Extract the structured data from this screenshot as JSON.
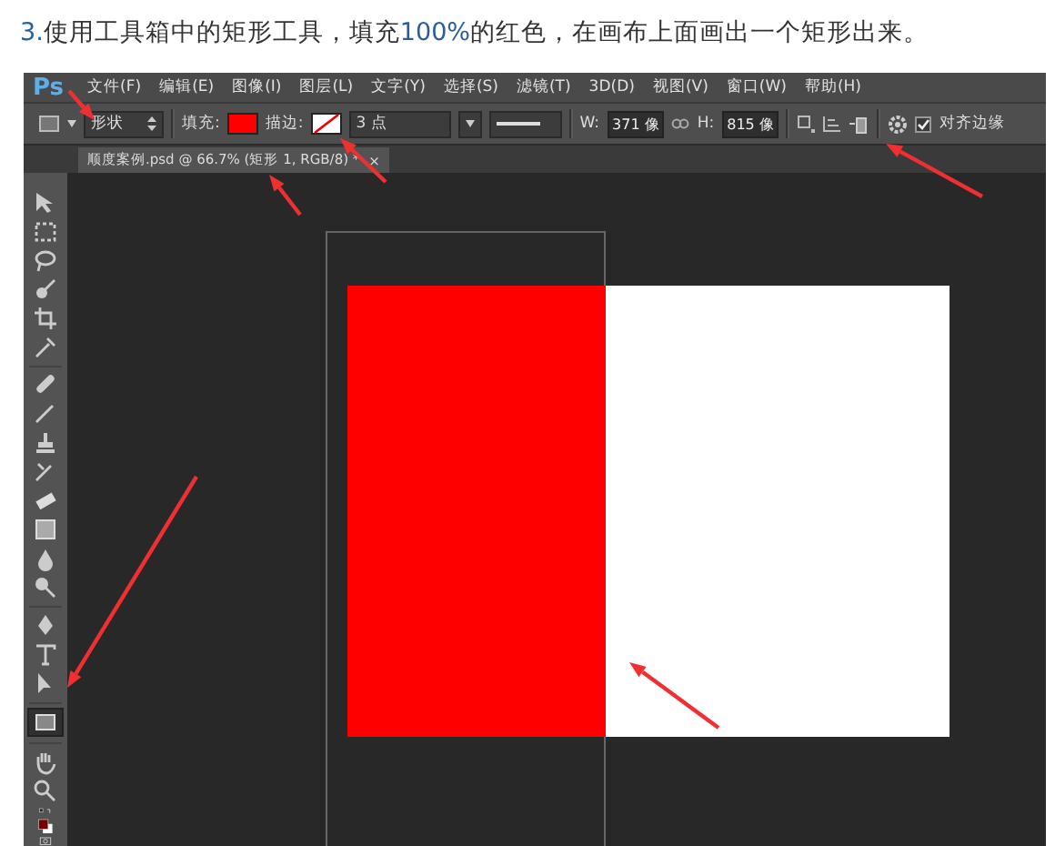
{
  "heading": [
    {
      "text": "3.",
      "kind": "number"
    },
    {
      "text": "使用工具箱中的矩形工具，填充",
      "kind": "plain"
    },
    {
      "text": "100%",
      "kind": "number"
    },
    {
      "text": "的红色，在画布上面画出一个矩形出来。",
      "kind": "plain"
    }
  ],
  "app": {
    "logo": "Ps",
    "menu": [
      "文件(F)",
      "编辑(E)",
      "图像(I)",
      "图层(L)",
      "文字(Y)",
      "选择(S)",
      "滤镜(T)",
      "3D(D)",
      "视图(V)",
      "窗口(W)",
      "帮助(H)"
    ],
    "options": {
      "mode": "形状",
      "fill_label": "填充:",
      "stroke_label": "描边:",
      "stroke_width": "3 点",
      "w_label": "W:",
      "w_value": "371 像",
      "h_label": "H:",
      "h_value": "815 像",
      "align_edges": {
        "label": "对齐边缘",
        "checked": true
      }
    },
    "tab": {
      "title": "顺度案例.psd @ 66.7% (矩形 1, RGB/8) *",
      "close": "×"
    },
    "tools": [
      {
        "selected": false
      },
      {
        "selected": false
      },
      {
        "selected": false
      },
      {
        "selected": false
      },
      {
        "selected": false
      },
      {
        "selected": false
      },
      {
        "selected": false
      },
      {
        "selected": false
      },
      {
        "selected": false
      },
      {
        "selected": false
      },
      {
        "selected": false
      },
      {
        "selected": false
      },
      {
        "selected": false
      },
      {
        "selected": false
      },
      {
        "selected": false
      },
      {
        "selected": false
      },
      {
        "selected": false
      },
      {
        "selected": true
      },
      {
        "selected": false
      },
      {
        "selected": false
      }
    ]
  }
}
